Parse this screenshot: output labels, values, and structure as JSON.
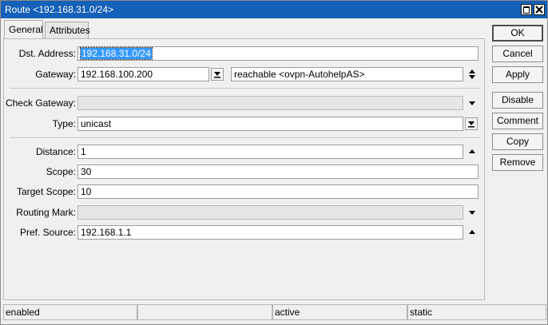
{
  "window": {
    "title": "Route <192.168.31.0/24>"
  },
  "tabs": [
    {
      "label": "General",
      "active": true
    },
    {
      "label": "Attributes",
      "active": false
    }
  ],
  "fields": {
    "dst_address": {
      "label": "Dst. Address:",
      "value": "192.168.31.0/24"
    },
    "gateway": {
      "label": "Gateway:",
      "value": "192.168.100.200",
      "status": "reachable <ovpn-AutohelpAS>"
    },
    "check_gateway": {
      "label": "Check Gateway:",
      "value": ""
    },
    "type": {
      "label": "Type:",
      "value": "unicast"
    },
    "distance": {
      "label": "Distance:",
      "value": "1"
    },
    "scope": {
      "label": "Scope:",
      "value": "30"
    },
    "target_scope": {
      "label": "Target Scope:",
      "value": "10"
    },
    "routing_mark": {
      "label": "Routing Mark:",
      "value": ""
    },
    "pref_source": {
      "label": "Pref. Source:",
      "value": "192.168.1.1"
    }
  },
  "buttons": {
    "ok": "OK",
    "cancel": "Cancel",
    "apply": "Apply",
    "disable": "Disable",
    "comment": "Comment",
    "copy": "Copy",
    "remove": "Remove"
  },
  "status_bar": [
    "enabled",
    "",
    "active",
    "static"
  ],
  "colors": {
    "titlebar": "#1560b8",
    "selection": "#3399ff"
  }
}
